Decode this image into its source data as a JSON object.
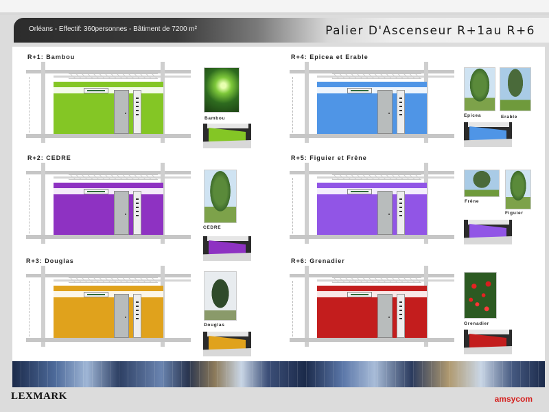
{
  "header": {
    "info": "Orléans  - Effectif: 360personnes  -  Bâtiment de 7200 m²",
    "title": "Palier D'Ascenseur  R+1au R+6"
  },
  "landings": [
    {
      "title": "R+1: Bambou",
      "wall_color": "#84c625"
    },
    {
      "title": "R+2: CEDRE",
      "wall_color": "#8e32c2"
    },
    {
      "title": "R+3: Douglas",
      "wall_color": "#e0a21c"
    },
    {
      "title": "R+4: Epicea et Erable",
      "wall_color": "#4f95e6"
    },
    {
      "title": "R+5: Figuier et Frêne",
      "wall_color": "#9155e6"
    },
    {
      "title": "R+6: Grenadier",
      "wall_color": "#c31d1d"
    }
  ],
  "photos": {
    "bambou": "Bambou",
    "cedre": "CEDRE",
    "douglas": "Douglas",
    "epicea": "Epicea",
    "erable": "Erable",
    "frene": "Frêne",
    "figuier": "Figuier",
    "grenadier": "Grenadier"
  },
  "footer": {
    "logo_left": "LEXMARK",
    "logo_right": "amsycom"
  }
}
